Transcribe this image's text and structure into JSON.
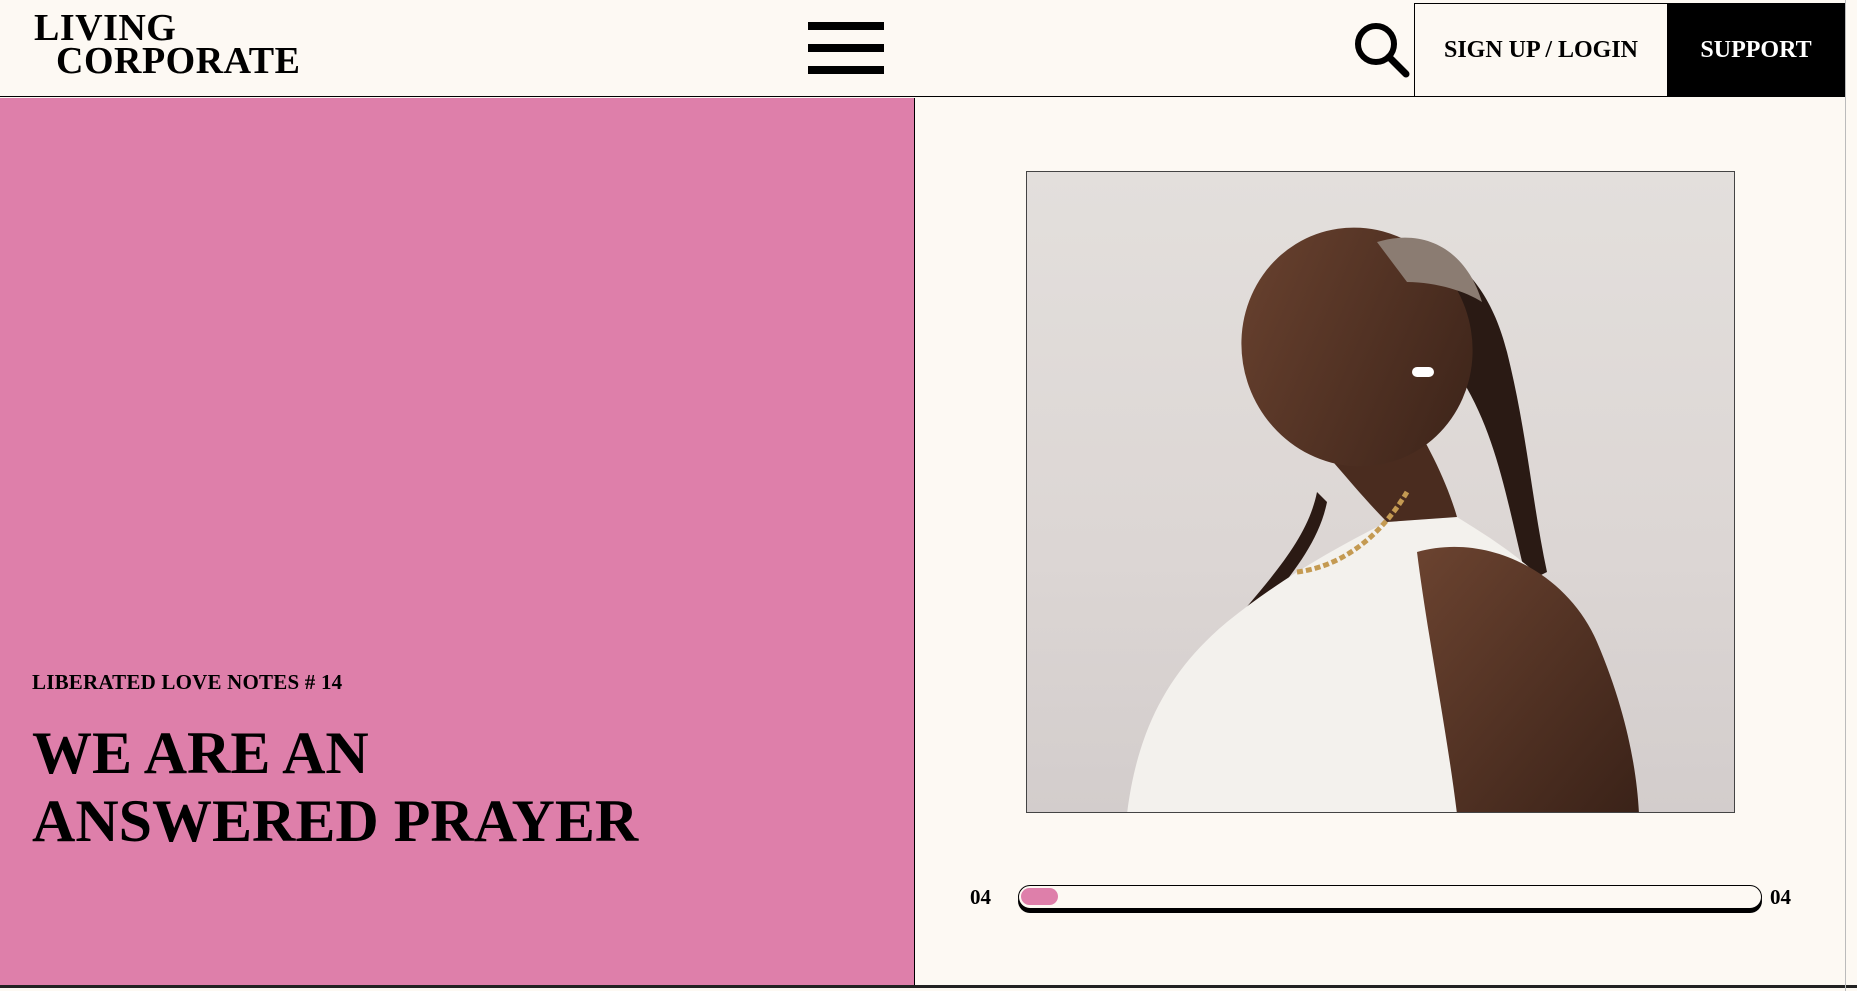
{
  "header": {
    "logo_line1": "LIVING",
    "logo_line2": "CORPORATE",
    "menu_icon": "hamburger-menu-icon",
    "search_icon": "search-icon",
    "signup_label": "SIGN UP / LOGIN",
    "support_label": "SUPPORT"
  },
  "hero": {
    "eyebrow": "LIBERATED LOVE NOTES # 14",
    "headline_line1": "WE ARE AN",
    "headline_line2": "ANSWERED PRAYER",
    "background_color": "#de7faa"
  },
  "slider": {
    "current_label": "04",
    "total_label": "04",
    "progress_fraction": 0.05,
    "accent_color": "#de7faa"
  },
  "image": {
    "description_icon": "photo-woman-with-earbuds"
  }
}
